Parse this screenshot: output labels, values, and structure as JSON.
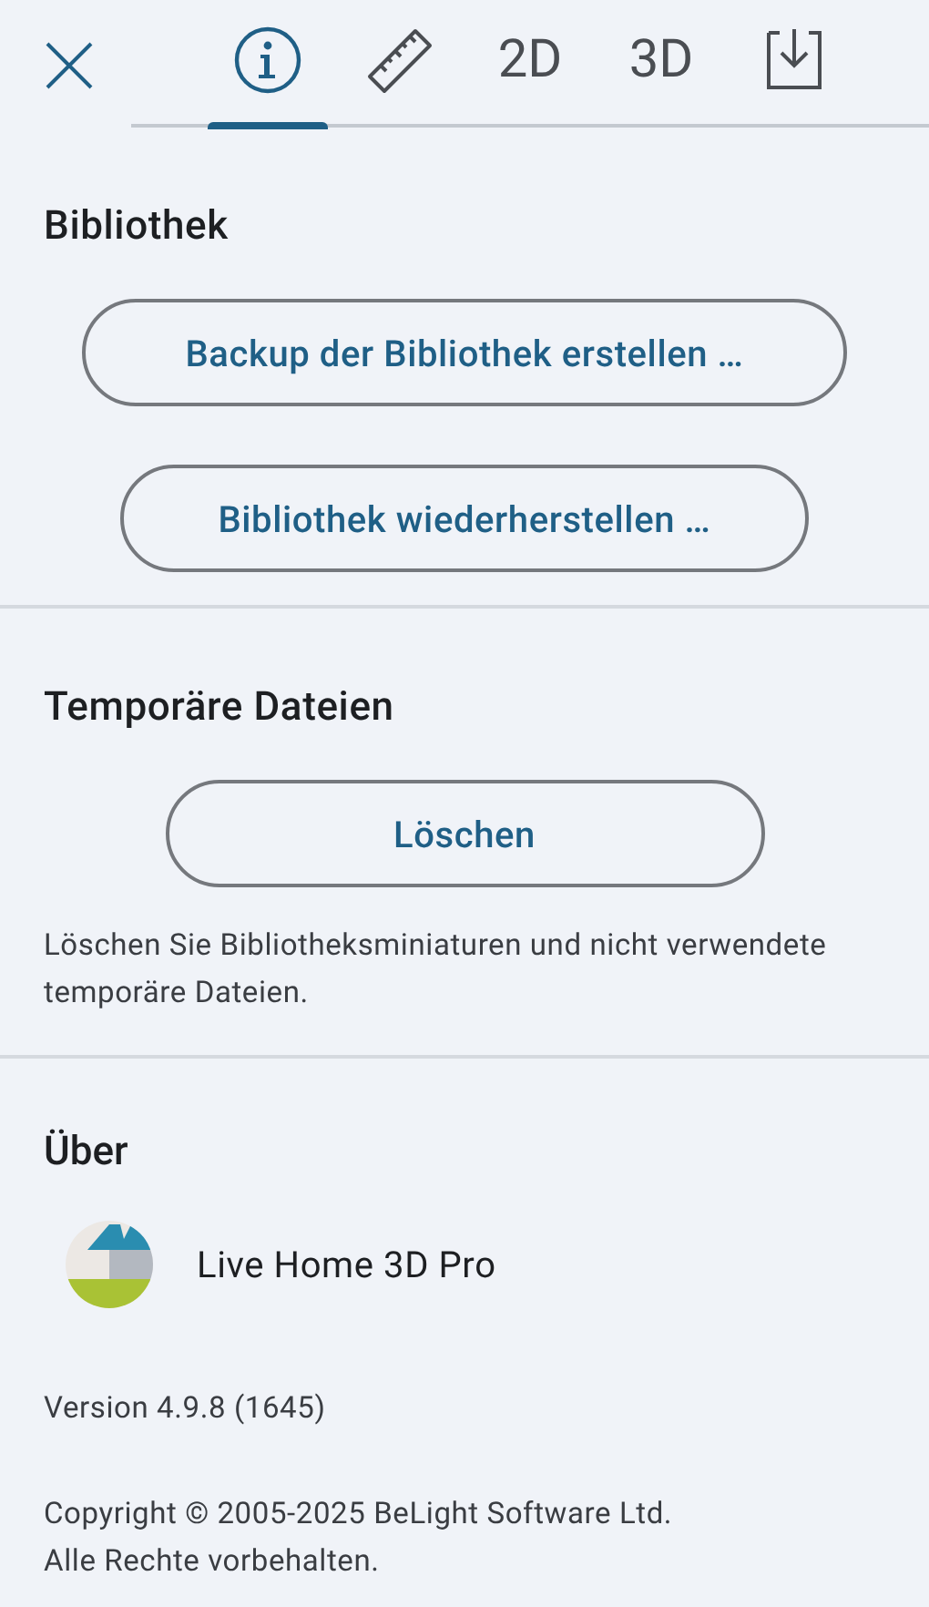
{
  "tabs": [
    {
      "kind": "info",
      "selected": true
    },
    {
      "kind": "ruler",
      "selected": false
    },
    {
      "kind": "text",
      "label": "2D",
      "selected": false
    },
    {
      "kind": "text",
      "label": "3D",
      "selected": false
    },
    {
      "kind": "download",
      "selected": false
    }
  ],
  "sections": [
    {
      "title": "Bibliothek",
      "buttons": [
        "Backup der Bibliothek erstellen …",
        "Bibliothek wiederherstellen …"
      ]
    },
    {
      "title": "Temporäre Dateien",
      "buttons": [
        "Löschen"
      ],
      "note": "Löschen Sie Bibliotheksminiaturen und nicht verwendete temporäre Dateien."
    }
  ],
  "about": {
    "title": "Über",
    "app_name": "Live Home 3D Pro",
    "version": "Version 4.9.8 (1645)",
    "copyright": "Copyright © 2005-2025 BeLight Software Ltd.\nAlle Rechte vorbehalten."
  }
}
